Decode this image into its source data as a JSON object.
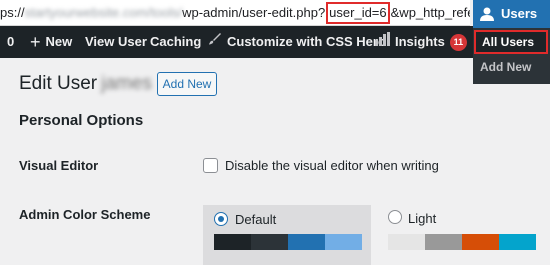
{
  "url": {
    "prefix": "ps://",
    "blurred": "startyourwebsite.com/tools/",
    "path": "wp-admin/user-edit.php?",
    "highlight": "user_id=6",
    "suffix": "&wp_http_referer="
  },
  "adminbar": {
    "count": "0",
    "new_label": "New",
    "view_user": "View User",
    "caching": "Caching",
    "customize": "Customize with CSS Hero",
    "insights": "Insights",
    "insights_badge": "11"
  },
  "users_menu": {
    "title": "Users",
    "items": [
      "All Users",
      "Add New"
    ]
  },
  "page": {
    "title": "Edit User",
    "username": "james",
    "add_new": "Add New",
    "section": "Personal Options",
    "visual_editor_label": "Visual Editor",
    "visual_editor_option": "Disable the visual editor when writing",
    "color_scheme_label": "Admin Color Scheme",
    "schemes": [
      {
        "name": "Default",
        "selected": true,
        "colors": [
          "#1d2327",
          "#2c3338",
          "#2271b1",
          "#72aee6"
        ]
      },
      {
        "name": "Light",
        "selected": false,
        "colors": [
          "#e5e5e5",
          "#999999",
          "#d64e07",
          "#04a4cc"
        ]
      }
    ]
  }
}
